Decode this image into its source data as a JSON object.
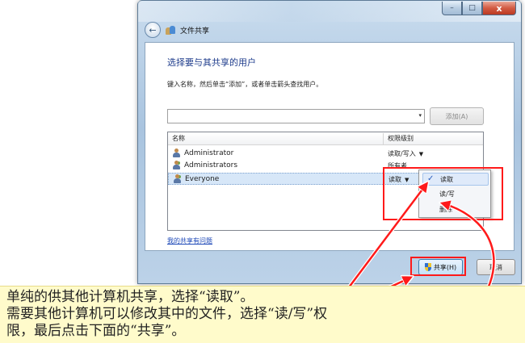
{
  "window": {
    "minimize_glyph": "–",
    "maximize_glyph": "□",
    "close_glyph": "x",
    "back_glyph": "←",
    "title": "文件共享"
  },
  "content": {
    "heading": "选择要与其共享的用户",
    "instruction": "键入名称，然后单击“添加”，或者单击箭头查找用户。",
    "name_input_value": "",
    "combo_arrow": "▾",
    "add_button": "添加(A)",
    "list": {
      "headers": {
        "name": "名称",
        "permission": "权限级别"
      },
      "rows": [
        {
          "name": "Administrator",
          "permission": "读取/写入",
          "has_caret": true
        },
        {
          "name": "Administrators",
          "permission": "所有者",
          "has_caret": false
        },
        {
          "name": "Everyone",
          "permission": "读取",
          "has_caret": true,
          "selected": true
        }
      ]
    },
    "help_link": "我的共享有问题"
  },
  "permission_menu": {
    "items": [
      "读取",
      "读/写",
      "删除"
    ],
    "checked_index": 0,
    "check_glyph": "✓"
  },
  "buttons": {
    "share": "共享(H)",
    "cancel": "取消"
  },
  "annotation": {
    "lines": [
      "单纯的供其他计算机共享，选择“读取”。",
      "需要其他计算机可以修改其中的文件，选择“读/写”权",
      "限，最后点击下面的“共享”。"
    ]
  },
  "colors": {
    "highlight": "#ff1a1a",
    "note_background": "#fffbcb",
    "heading": "#1e3c8c",
    "link": "#1f4ab8"
  },
  "icons": {
    "back": "back-arrow-icon",
    "title": "shared-users-icon",
    "user": "user-icon",
    "group": "user-group-icon",
    "check": "check-icon",
    "shield": "uac-shield-icon"
  }
}
